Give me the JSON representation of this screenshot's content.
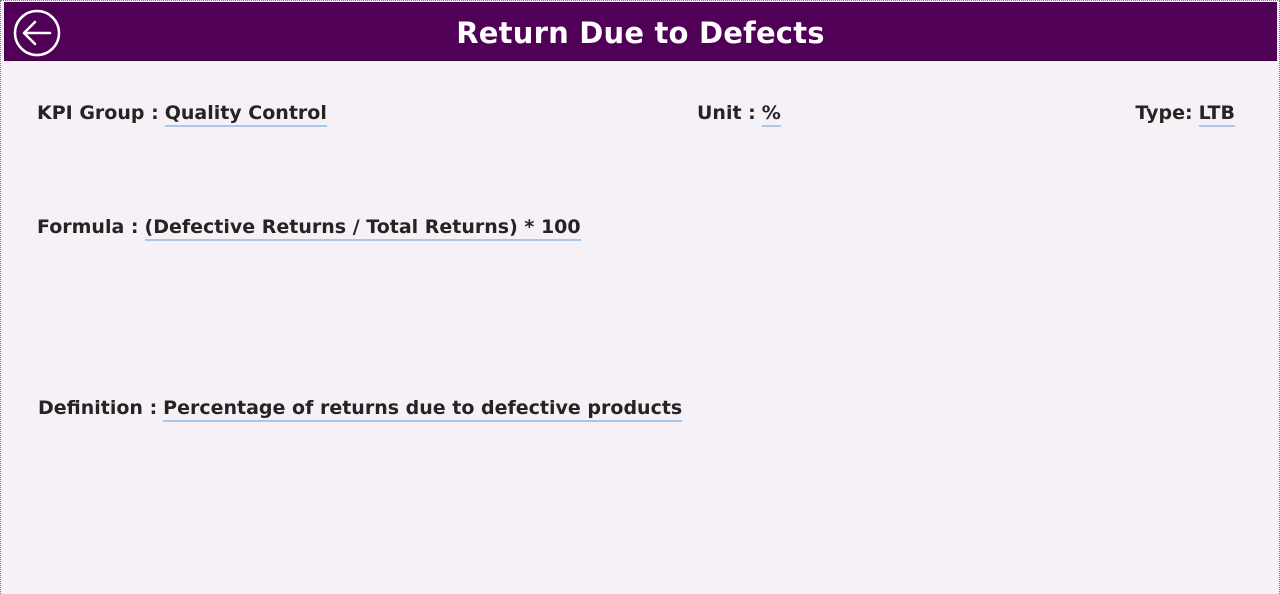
{
  "header": {
    "title": "Return Due to Defects",
    "back_icon": "arrow-left-circle-icon",
    "background_color": "#500057"
  },
  "kpi": {
    "group_label": "KPI Group :",
    "group_value": "Quality Control",
    "unit_label": "Unit :",
    "unit_value": "%",
    "type_label": "Type:",
    "type_value": "LTB",
    "formula_label": "Formula :",
    "formula_value": "(Defective Returns / Total Returns) * 100",
    "definition_label": "Definition :",
    "definition_value": "Percentage of returns due to defective products"
  }
}
